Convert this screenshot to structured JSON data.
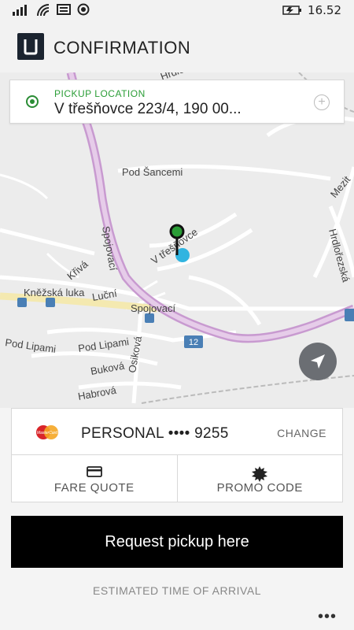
{
  "status_bar": {
    "time": "16.52",
    "icons": [
      "signal-icon",
      "wifi-icon",
      "message-icon",
      "location-icon",
      "battery-icon"
    ]
  },
  "header": {
    "title": "CONFIRMATION"
  },
  "pickup": {
    "label": "PICKUP LOCATION",
    "address": "V třešňovce 223/4, 190 00..."
  },
  "map": {
    "streets": [
      "Pod Šancemi",
      "Spojovací",
      "Kněžská luka",
      "Křivá",
      "Luční",
      "Pod Lipami",
      "Buková",
      "Osiková",
      "Habrová",
      "Hrdlořezská",
      "Mezitraťová",
      "Hrdlořezská"
    ],
    "route_number": "12",
    "pin_label": "V třešňovce"
  },
  "payment": {
    "name": "PERSONAL •••• 9255",
    "change_label": "CHANGE"
  },
  "actions": {
    "fare_quote": "FARE QUOTE",
    "promo_code": "PROMO CODE"
  },
  "request_button": "Request pickup here",
  "eta": "ESTIMATED TIME OF ARRIVAL",
  "more": "•••",
  "colors": {
    "accent_green": "#2a9d36",
    "button_bg": "#000000",
    "route_pink": "#c89ad0",
    "pin_blue": "#30b4e0"
  }
}
